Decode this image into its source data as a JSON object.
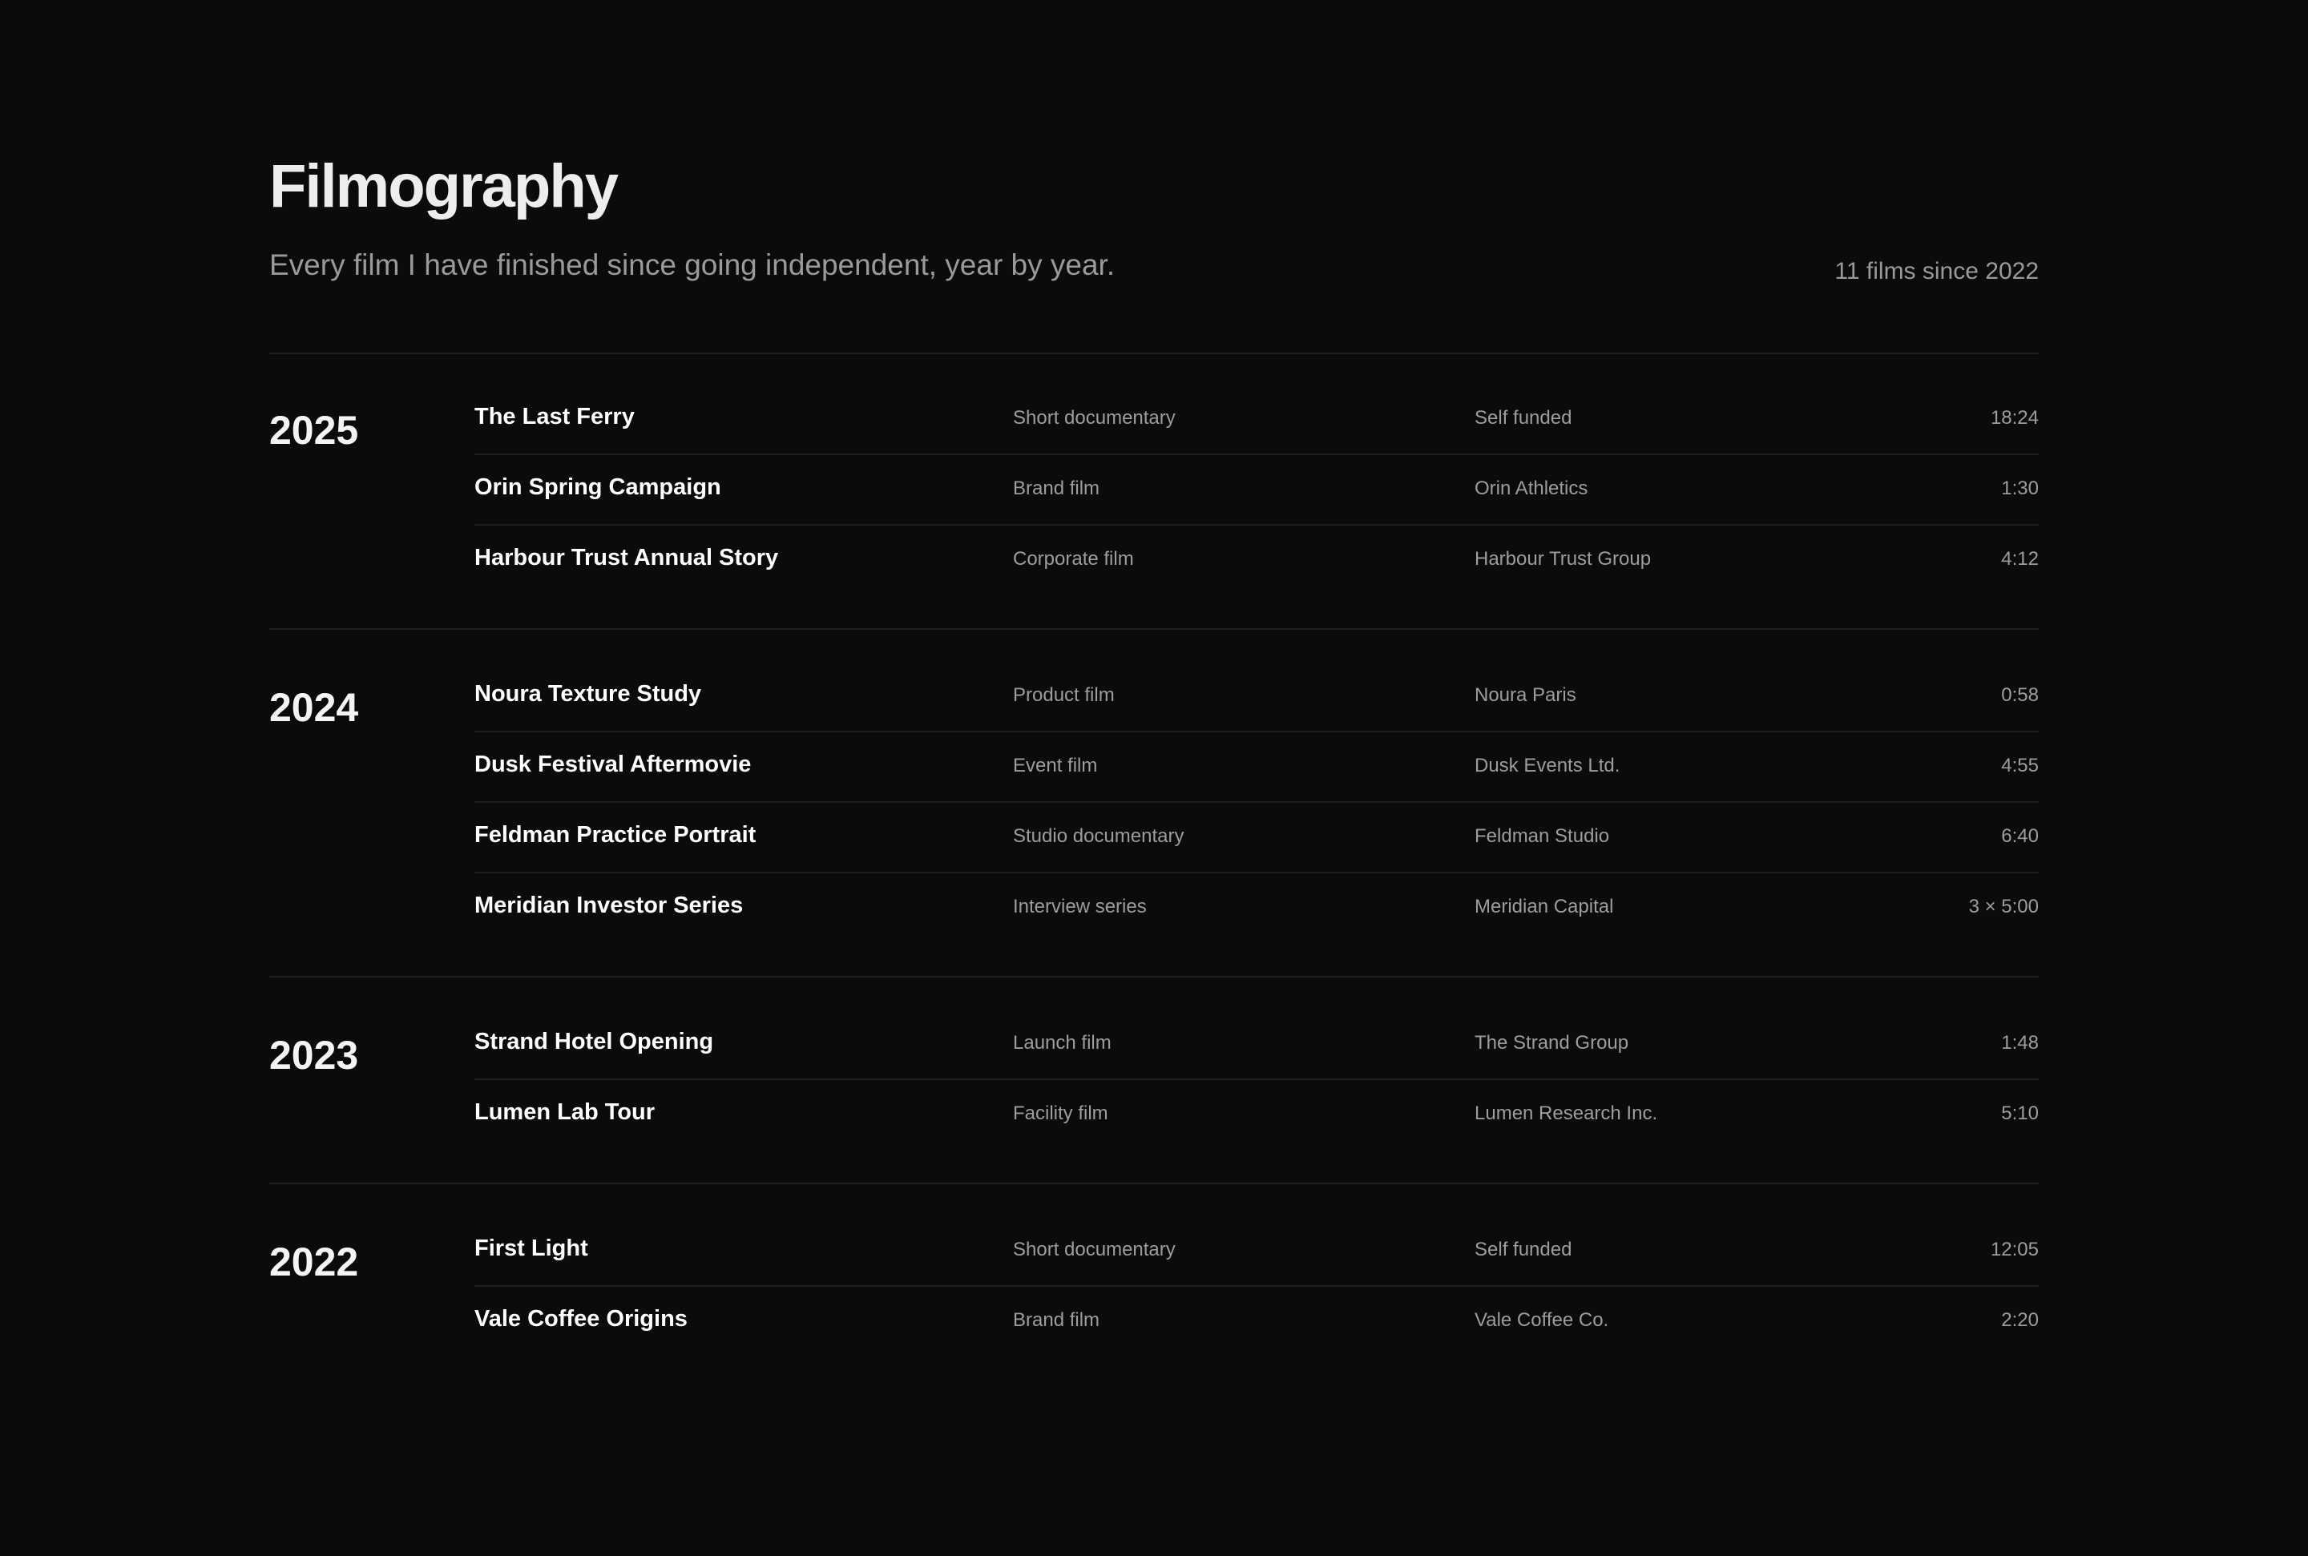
{
  "header": {
    "title": "Filmography",
    "subtitle": "Every film I have finished since going independent, year by year.",
    "count": "11 films since 2022"
  },
  "years": [
    {
      "year": "2025",
      "films": [
        {
          "title": "The Last Ferry",
          "type": "Short documentary",
          "client": "Self funded",
          "duration": "18:24"
        },
        {
          "title": "Orin Spring Campaign",
          "type": "Brand film",
          "client": "Orin Athletics",
          "duration": "1:30"
        },
        {
          "title": "Harbour Trust Annual Story",
          "type": "Corporate film",
          "client": "Harbour Trust Group",
          "duration": "4:12"
        }
      ]
    },
    {
      "year": "2024",
      "films": [
        {
          "title": "Noura Texture Study",
          "type": "Product film",
          "client": "Noura Paris",
          "duration": "0:58"
        },
        {
          "title": "Dusk Festival Aftermovie",
          "type": "Event film",
          "client": "Dusk Events Ltd.",
          "duration": "4:55"
        },
        {
          "title": "Feldman Practice Portrait",
          "type": "Studio documentary",
          "client": "Feldman Studio",
          "duration": "6:40"
        },
        {
          "title": "Meridian Investor Series",
          "type": "Interview series",
          "client": "Meridian Capital",
          "duration": "3 × 5:00"
        }
      ]
    },
    {
      "year": "2023",
      "films": [
        {
          "title": "Strand Hotel Opening",
          "type": "Launch film",
          "client": "The Strand Group",
          "duration": "1:48"
        },
        {
          "title": "Lumen Lab Tour",
          "type": "Facility film",
          "client": "Lumen Research Inc.",
          "duration": "5:10"
        }
      ]
    },
    {
      "year": "2022",
      "films": [
        {
          "title": "First Light",
          "type": "Short documentary",
          "client": "Self funded",
          "duration": "12:05"
        },
        {
          "title": "Vale Coffee Origins",
          "type": "Brand film",
          "client": "Vale Coffee Co.",
          "duration": "2:20"
        }
      ]
    }
  ]
}
